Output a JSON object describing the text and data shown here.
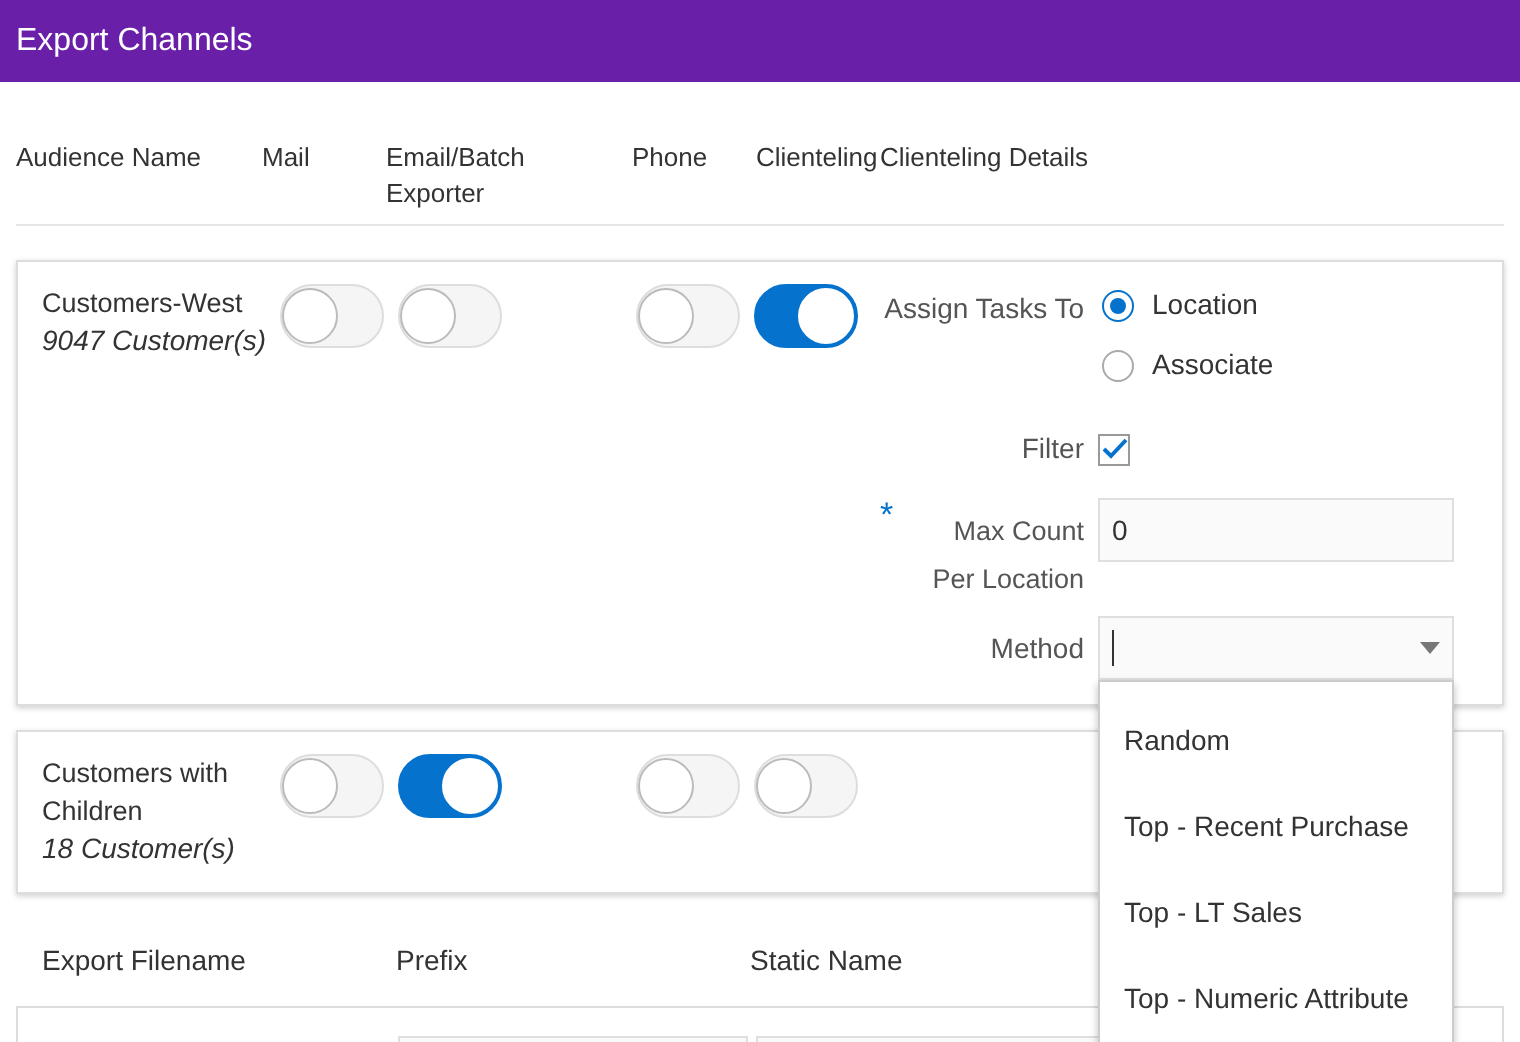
{
  "header": {
    "title": "Export Channels"
  },
  "columns": [
    "Audience Name",
    "Mail",
    "Email/Batch Exporter",
    "Phone",
    "Clienteling",
    "Clienteling Details"
  ],
  "audiences": [
    {
      "name": "Customers-West",
      "count": "9047 Customer(s)",
      "channels": [
        {
          "on": false
        },
        {
          "on": false
        },
        {
          "on": false
        },
        {
          "on": true
        }
      ],
      "show_details": true
    },
    {
      "name": "Customers with Children",
      "count": "18 Customer(s)",
      "channels": [
        {
          "on": false
        },
        {
          "on": true
        },
        {
          "on": false
        },
        {
          "on": false
        }
      ],
      "show_details": false
    }
  ],
  "details": {
    "assign_label": "Assign Tasks To",
    "assign_options": [
      {
        "label": "Location",
        "selected": true
      },
      {
        "label": "Associate",
        "selected": false
      }
    ],
    "filter": {
      "label": "Filter",
      "checked": true
    },
    "max_count": {
      "label": "Max Count Per Location",
      "required": true,
      "required_mark": "*",
      "value": "0"
    },
    "method": {
      "label": "Method",
      "expanded": true,
      "options": [
        "Random",
        "Top - Recent Purchase",
        "Top - LT Sales",
        "Top - Numeric Attribute"
      ]
    }
  },
  "export": {
    "columns": [
      "Export Filename",
      "Prefix",
      "Static Name"
    ]
  }
}
